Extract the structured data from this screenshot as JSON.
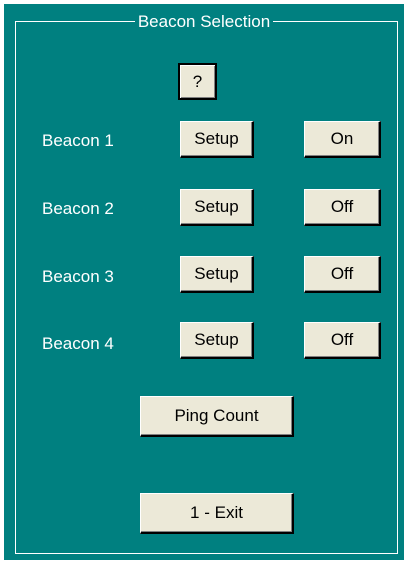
{
  "group": {
    "title": "Beacon Selection",
    "help_label": "?"
  },
  "beacons": [
    {
      "label": "Beacon 1",
      "setup_label": "Setup",
      "state_label": "On"
    },
    {
      "label": "Beacon 2",
      "setup_label": "Setup",
      "state_label": "Off"
    },
    {
      "label": "Beacon 3",
      "setup_label": "Setup",
      "state_label": "Off"
    },
    {
      "label": "Beacon 4",
      "setup_label": "Setup",
      "state_label": "Off"
    }
  ],
  "actions": {
    "ping_count_label": "Ping Count",
    "exit_label": "1 - Exit"
  },
  "colors": {
    "background": "#008080",
    "button_face": "#ece9d8",
    "text_on_background": "#ffffff"
  }
}
